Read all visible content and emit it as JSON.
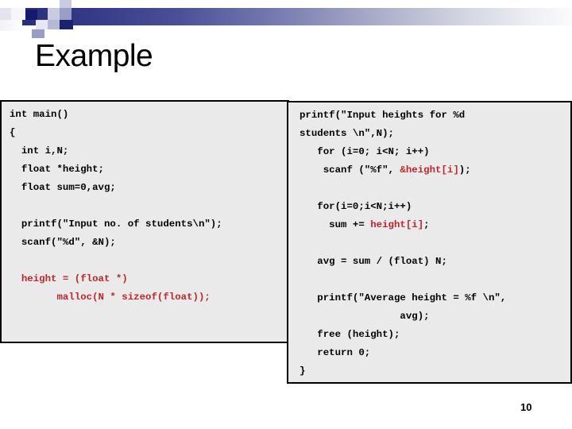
{
  "slide": {
    "title": "Example",
    "page_number": "10",
    "accent_navy": "#151a6e",
    "code_bg": "#eaeaea",
    "code_border": "#000000",
    "highlight_red": "#c0262b"
  },
  "code_left": {
    "lines": [
      [
        {
          "text": "int main()",
          "color": "black"
        }
      ],
      [
        {
          "text": "{",
          "color": "black"
        }
      ],
      [
        {
          "text": "  int i,N;",
          "color": "black"
        }
      ],
      [
        {
          "text": "  float *height;",
          "color": "black"
        }
      ],
      [
        {
          "text": "  float sum=0,avg;",
          "color": "black"
        }
      ],
      [
        {
          "text": "",
          "color": "black"
        }
      ],
      [
        {
          "text": "  printf(\"Input no. of students\\n\");",
          "color": "black"
        }
      ],
      [
        {
          "text": "  scanf(\"%d\", &N);",
          "color": "black"
        }
      ],
      [
        {
          "text": "",
          "color": "black"
        }
      ],
      [
        {
          "text": "  height = (float *)",
          "color": "red"
        }
      ],
      [
        {
          "text": "        malloc(N * sizeof(float));",
          "color": "red"
        }
      ]
    ]
  },
  "code_right": {
    "lines": [
      [
        {
          "text": "printf(\"Input heights for %d",
          "color": "black"
        }
      ],
      [
        {
          "text": "students \\n\",N);",
          "color": "black"
        }
      ],
      [
        {
          "text": "   for (i=0; i<N; i++)",
          "color": "black"
        }
      ],
      [
        {
          "text": "    scanf (\"%f\", ",
          "color": "black"
        },
        {
          "text": "&height[i]",
          "color": "red"
        },
        {
          "text": ");",
          "color": "black"
        }
      ],
      [
        {
          "text": "",
          "color": "black"
        }
      ],
      [
        {
          "text": "   for(i=0;i<N;i++)",
          "color": "black"
        }
      ],
      [
        {
          "text": "     sum += ",
          "color": "black"
        },
        {
          "text": "height[i]",
          "color": "red"
        },
        {
          "text": ";",
          "color": "black"
        }
      ],
      [
        {
          "text": "",
          "color": "black"
        }
      ],
      [
        {
          "text": "   avg = sum / (float) N;",
          "color": "black"
        }
      ],
      [
        {
          "text": "",
          "color": "black"
        }
      ],
      [
        {
          "text": "   printf(\"Average height = %f \\n\",",
          "color": "black"
        }
      ],
      [
        {
          "text": "                 avg);",
          "color": "black"
        }
      ],
      [
        {
          "text": "   free (height);",
          "color": "black"
        }
      ],
      [
        {
          "text": "   return 0;",
          "color": "black"
        }
      ],
      [
        {
          "text": "}",
          "color": "black"
        }
      ]
    ]
  }
}
